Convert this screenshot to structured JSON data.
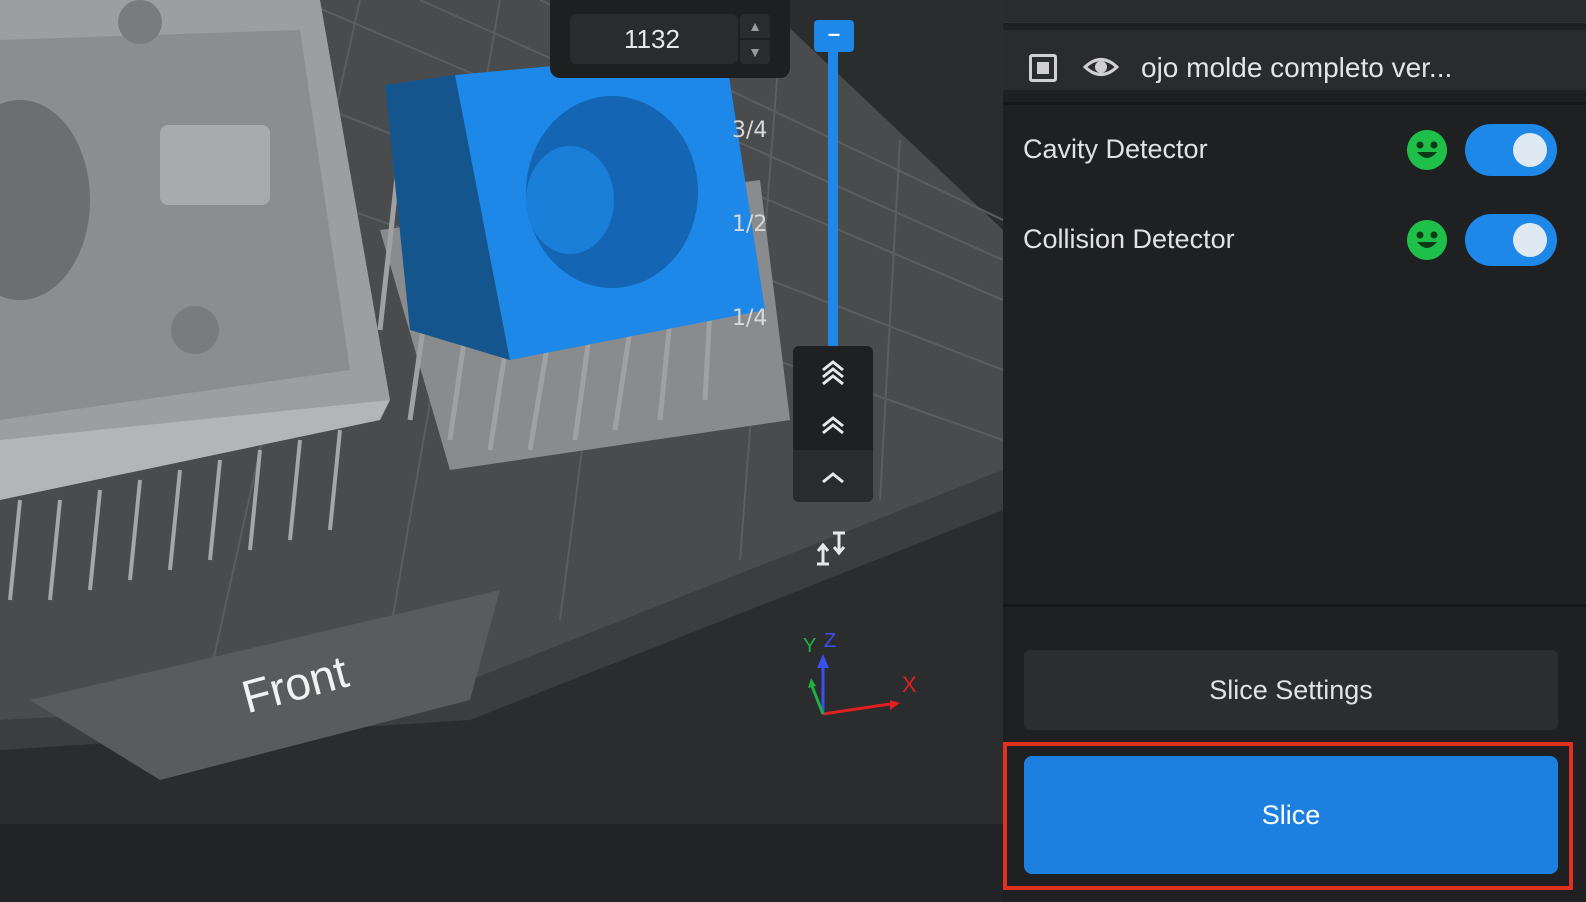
{
  "viewport": {
    "layer_value": "1132",
    "fractions": [
      "3/4",
      "1/2",
      "1/4"
    ],
    "front_label": "Front",
    "axes": {
      "x": "X",
      "y": "Y",
      "z": "Z"
    },
    "nav_icons": [
      "double-chevron-up-icon",
      "chevron-double-up-icon",
      "chevron-up-icon"
    ],
    "model_color": "#1d88e8"
  },
  "panel": {
    "object_name": "ojo molde completo ver...",
    "detectors": [
      {
        "label": "Cavity Detector",
        "enabled": true,
        "status_icon": "smile-icon"
      },
      {
        "label": "Collision Detector",
        "enabled": true,
        "status_icon": "smile-icon"
      }
    ],
    "slice_settings_label": "Slice Settings",
    "slice_label": "Slice"
  },
  "colors": {
    "accent": "#1d88e8",
    "status_ok": "#1ec04a",
    "highlight": "#e03020"
  }
}
